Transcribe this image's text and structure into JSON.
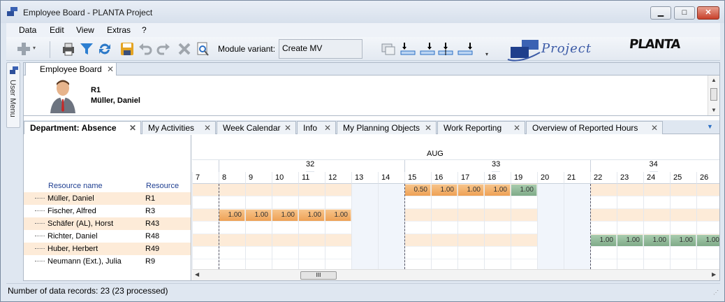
{
  "window": {
    "title": "Employee Board - PLANTA Project"
  },
  "menu": [
    "Data",
    "Edit",
    "View",
    "Extras",
    "?"
  ],
  "toolbar": {
    "module_variant_label": "Module variant:",
    "module_variant_value": "Create MV",
    "logo_project": "Project",
    "logo_planta": "PLANTA"
  },
  "user_menu": "User Menu",
  "doc_tab": "Employee Board",
  "resource": {
    "id": "R1",
    "name": "Müller, Daniel"
  },
  "view_tabs": [
    "Department: Absence",
    "My Activities",
    "Week Calendar",
    "Info",
    "My Planning Objects",
    "Work Reporting",
    "Overview of Reported Hours"
  ],
  "table": {
    "col_name": "Resource name",
    "col_resource": "Resource",
    "rows": [
      {
        "name": "Müller, Daniel",
        "resource": "R1"
      },
      {
        "name": "Fischer, Alfred",
        "resource": "R3"
      },
      {
        "name": "Schäfer (AL), Horst",
        "resource": "R43"
      },
      {
        "name": "Richter, Daniel",
        "resource": "R48"
      },
      {
        "name": "Huber, Herbert",
        "resource": "R49"
      },
      {
        "name": "Neumann (Ext.), Julia",
        "resource": "R9"
      }
    ]
  },
  "gantt": {
    "month": "AUG",
    "weeks": [
      "32",
      "33",
      "34"
    ],
    "days": [
      "7",
      "8",
      "9",
      "10",
      "11",
      "12",
      "13",
      "14",
      "15",
      "16",
      "17",
      "18",
      "19",
      "20",
      "21",
      "22",
      "23",
      "24",
      "25",
      "26"
    ],
    "bars": [
      {
        "row": 0,
        "day": "15",
        "value": "0.50",
        "color": "orange"
      },
      {
        "row": 0,
        "day": "16",
        "value": "1.00",
        "color": "orange"
      },
      {
        "row": 0,
        "day": "17",
        "value": "1.00",
        "color": "orange"
      },
      {
        "row": 0,
        "day": "18",
        "value": "1.00",
        "color": "orange"
      },
      {
        "row": 0,
        "day": "19",
        "value": "1.00",
        "color": "green"
      },
      {
        "row": 2,
        "day": "8",
        "value": "1.00",
        "color": "orange"
      },
      {
        "row": 2,
        "day": "9",
        "value": "1.00",
        "color": "orange"
      },
      {
        "row": 2,
        "day": "10",
        "value": "1.00",
        "color": "orange"
      },
      {
        "row": 2,
        "day": "11",
        "value": "1.00",
        "color": "orange"
      },
      {
        "row": 2,
        "day": "12",
        "value": "1.00",
        "color": "orange"
      },
      {
        "row": 4,
        "day": "22",
        "value": "1.00",
        "color": "green"
      },
      {
        "row": 4,
        "day": "23",
        "value": "1.00",
        "color": "green"
      },
      {
        "row": 4,
        "day": "24",
        "value": "1.00",
        "color": "green"
      },
      {
        "row": 4,
        "day": "25",
        "value": "1.00",
        "color": "green"
      },
      {
        "row": 4,
        "day": "26",
        "value": "1.00",
        "color": "green"
      }
    ],
    "weekend_days": [
      "13",
      "14",
      "20",
      "21"
    ]
  },
  "status": {
    "text": "Number of data records:  23 (23 processed)"
  },
  "colors": {
    "orange": "#eea155",
    "green": "#7fab88",
    "accent": "#2b6fc4"
  }
}
